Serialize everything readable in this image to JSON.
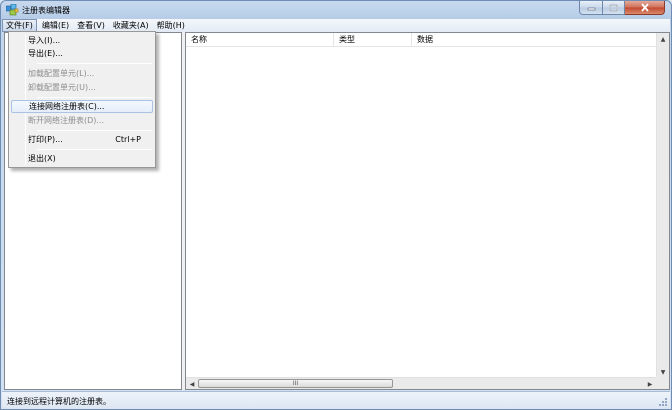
{
  "window": {
    "title": "注册表编辑器"
  },
  "menubar": {
    "items": [
      "文件(F)",
      "编辑(E)",
      "查看(V)",
      "收藏夹(A)",
      "帮助(H)"
    ]
  },
  "file_menu": {
    "import": "导入(I)...",
    "export": "导出(E)...",
    "load_hive": "加载配置单元(L)...",
    "unload_hive": "卸载配置单元(U)...",
    "connect_network": "连接网络注册表(C)...",
    "disconnect_network": "断开网络注册表(D)...",
    "print": "打印(P)...",
    "print_shortcut": "Ctrl+P",
    "exit": "退出(X)"
  },
  "list": {
    "columns": [
      "名称",
      "类型",
      "数据"
    ]
  },
  "hscroll": {
    "grip": "III"
  },
  "statusbar": {
    "text": "连接到远程计算机的注册表。"
  },
  "colors": {
    "menu_highlight": "#e5eef9",
    "title_gradient": "#b4cbe6",
    "close_button": "#c2472f"
  },
  "icons": [
    "regedit-app-icon",
    "minimize-icon",
    "maximize-icon",
    "close-icon",
    "scroll-up-icon",
    "scroll-down-icon",
    "scroll-left-icon",
    "scroll-right-icon",
    "size-grip-icon"
  ]
}
